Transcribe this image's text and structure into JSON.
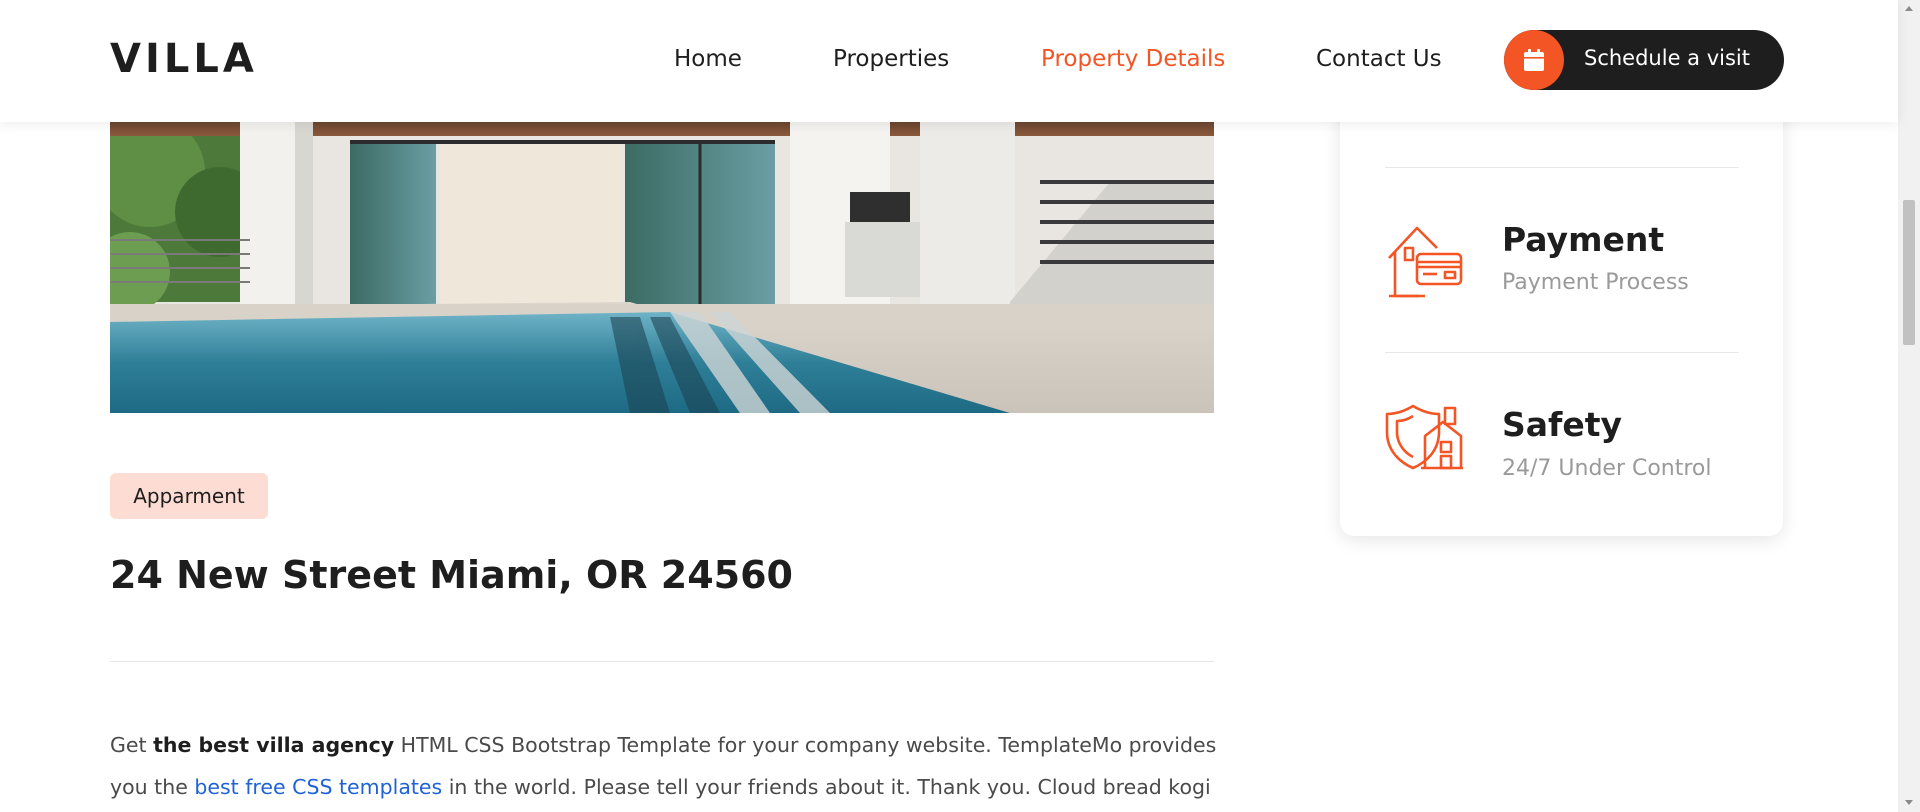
{
  "header": {
    "logo": "VILLA",
    "nav": [
      {
        "label": "Home",
        "active": false
      },
      {
        "label": "Properties",
        "active": false
      },
      {
        "label": "Property Details",
        "active": true
      },
      {
        "label": "Contact Us",
        "active": false
      }
    ],
    "cta": {
      "label": "Schedule a visit",
      "icon": "calendar-icon"
    }
  },
  "property": {
    "tag": "Apparment",
    "title": "24 New Street Miami, OR 24560",
    "description": {
      "p1": "Get ",
      "bold": "the best villa agency",
      "p2": " HTML CSS Bootstrap Template for your company website. TemplateMo provides you the ",
      "link": "best free CSS templates",
      "p3": " in the world. Please tell your friends about it. Thank you. Cloud bread kogi"
    }
  },
  "info_card": {
    "items": [
      {
        "title": "Payment",
        "subtitle": "Payment Process",
        "icon": "house-payment-icon"
      },
      {
        "title": "Safety",
        "subtitle": "24/7 Under Control",
        "icon": "shield-house-icon"
      }
    ]
  },
  "colors": {
    "accent": "#f35525",
    "dark": "#1e1e1e",
    "tag_bg": "#fdddd3",
    "link": "#1e62d6"
  }
}
